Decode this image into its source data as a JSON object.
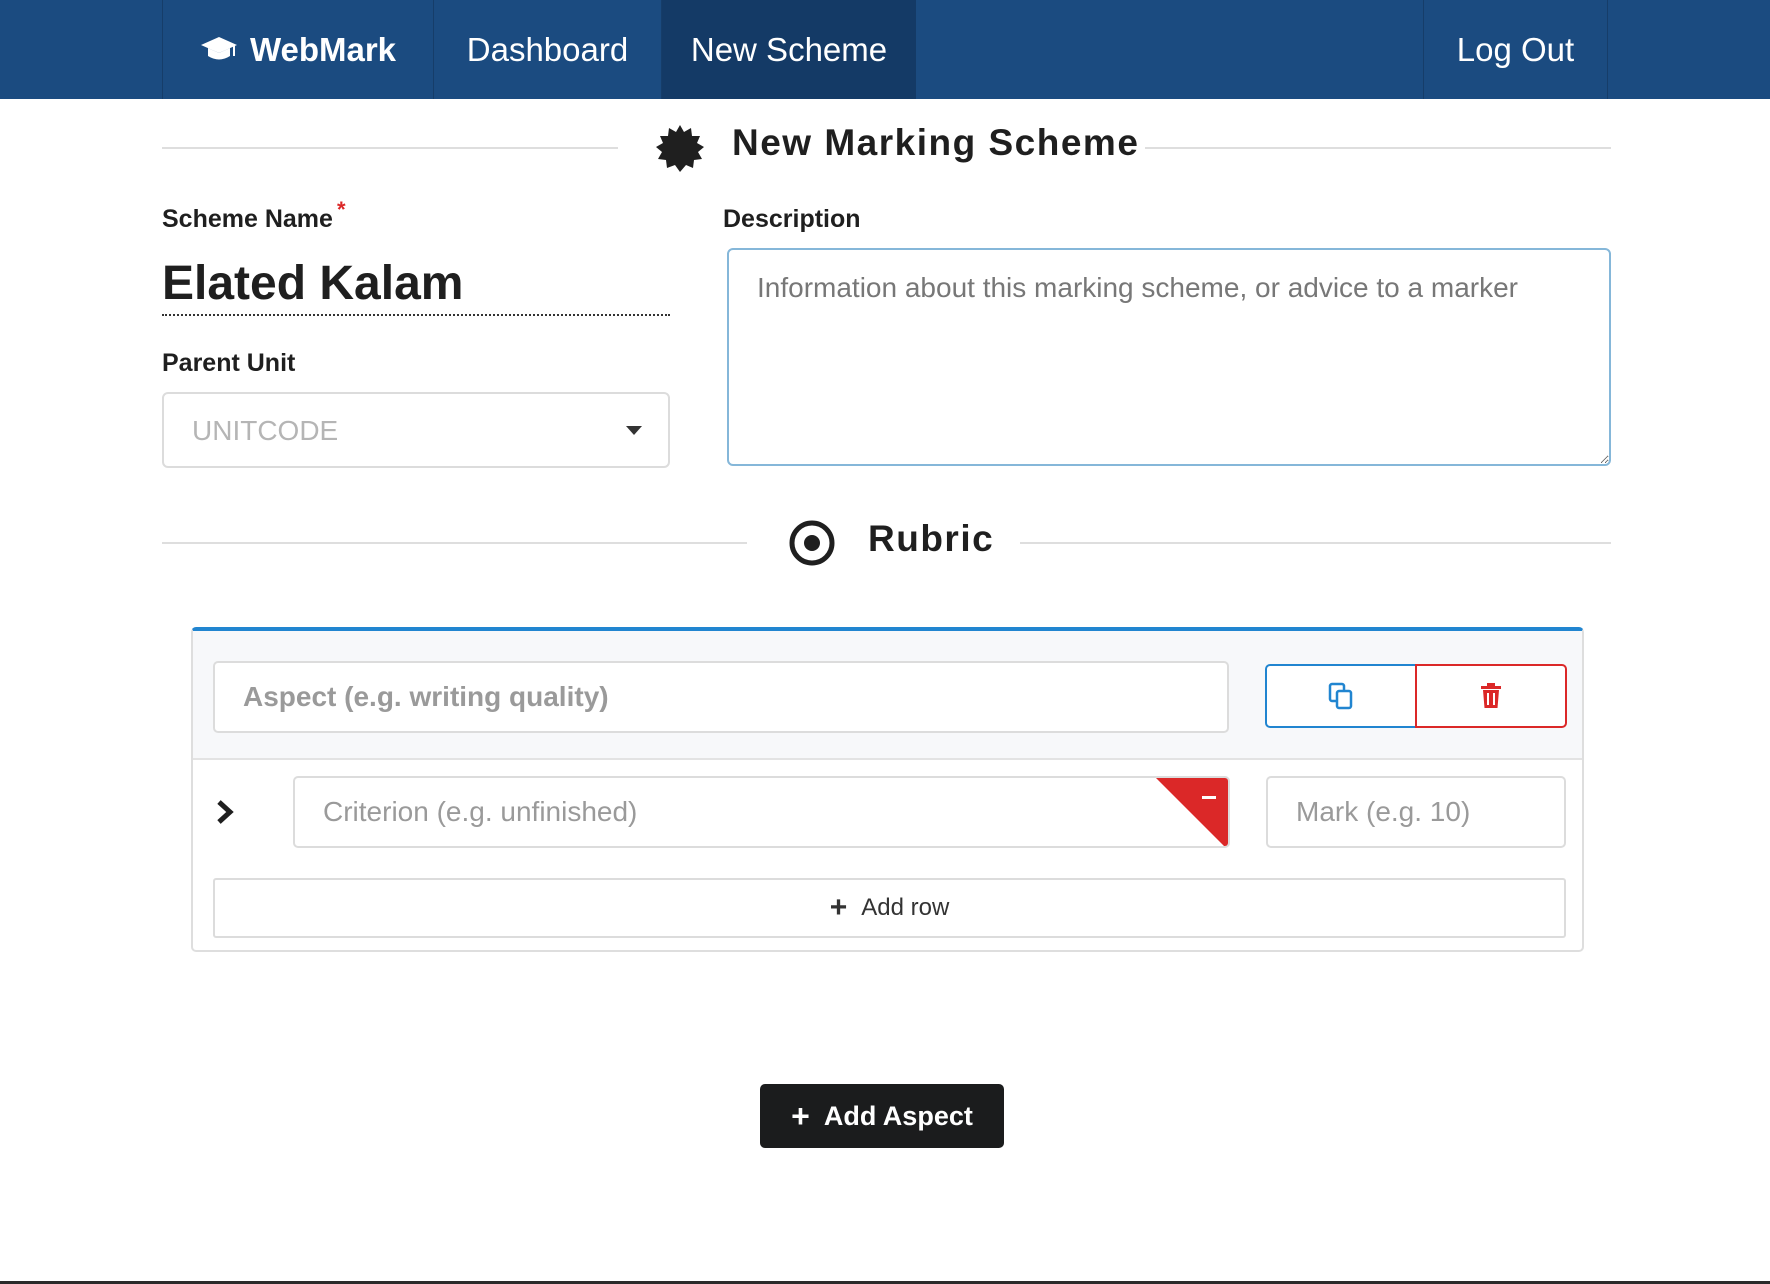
{
  "nav": {
    "brand": "WebMark",
    "brand_icon": "graduation-cap-icon",
    "dashboard": "Dashboard",
    "new_scheme": "New Scheme",
    "logout": "Log Out"
  },
  "header": {
    "title": "New Marking Scheme",
    "icon": "certificate-icon"
  },
  "form": {
    "scheme_name_label": "Scheme Name",
    "required_marker": "*",
    "scheme_name_value": "Elated Kalam",
    "parent_unit_label": "Parent Unit",
    "parent_unit_placeholder": "UNITCODE",
    "description_label": "Description",
    "description_placeholder": "Information about this marking scheme, or advice to a marker"
  },
  "rubric": {
    "title": "Rubric",
    "icon": "bullseye-icon",
    "aspects": [
      {
        "aspect_placeholder": "Aspect (e.g. writing quality)",
        "criterion_placeholder": "Criterion (e.g. unfinished)",
        "mark_placeholder": "Mark (e.g. 10)",
        "add_row_label": "Add row"
      }
    ]
  },
  "actions": {
    "add_aspect_label": "Add Aspect"
  },
  "colors": {
    "nav_bg": "#1b4b80",
    "nav_active_bg": "#143a66",
    "accent_blue": "#2185d0",
    "danger_red": "#db2828",
    "dark_button": "#1b1c1d"
  }
}
